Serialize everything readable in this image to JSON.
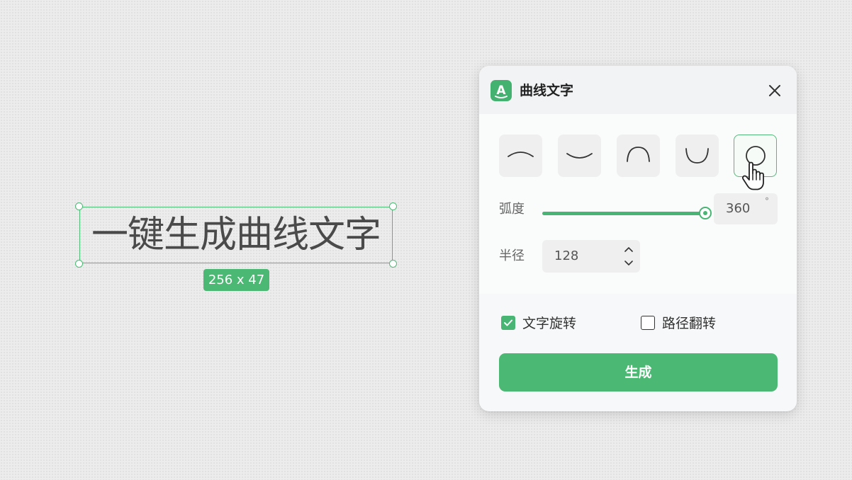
{
  "canvas": {
    "text": "一键生成曲线文字",
    "size_badge": "256 x 47"
  },
  "panel": {
    "title": "曲线文字",
    "logo_letter": "A",
    "accent_color": "#4bb873",
    "close_icon": "close-icon",
    "shapes": [
      {
        "name": "arc-down-shallow",
        "selected": false
      },
      {
        "name": "arc-up-shallow",
        "selected": false
      },
      {
        "name": "arc-down-deep",
        "selected": false
      },
      {
        "name": "arc-up-deep",
        "selected": false
      },
      {
        "name": "circle",
        "selected": true
      }
    ],
    "curvature": {
      "label": "弧度",
      "value": "360",
      "unit": "°",
      "fraction": 1.0
    },
    "radius": {
      "label": "半径",
      "value": "128"
    },
    "options": {
      "rotate_text": {
        "label": "文字旋转",
        "checked": true
      },
      "flip_path": {
        "label": "路径翻转",
        "checked": false
      }
    },
    "generate_label": "生成"
  }
}
